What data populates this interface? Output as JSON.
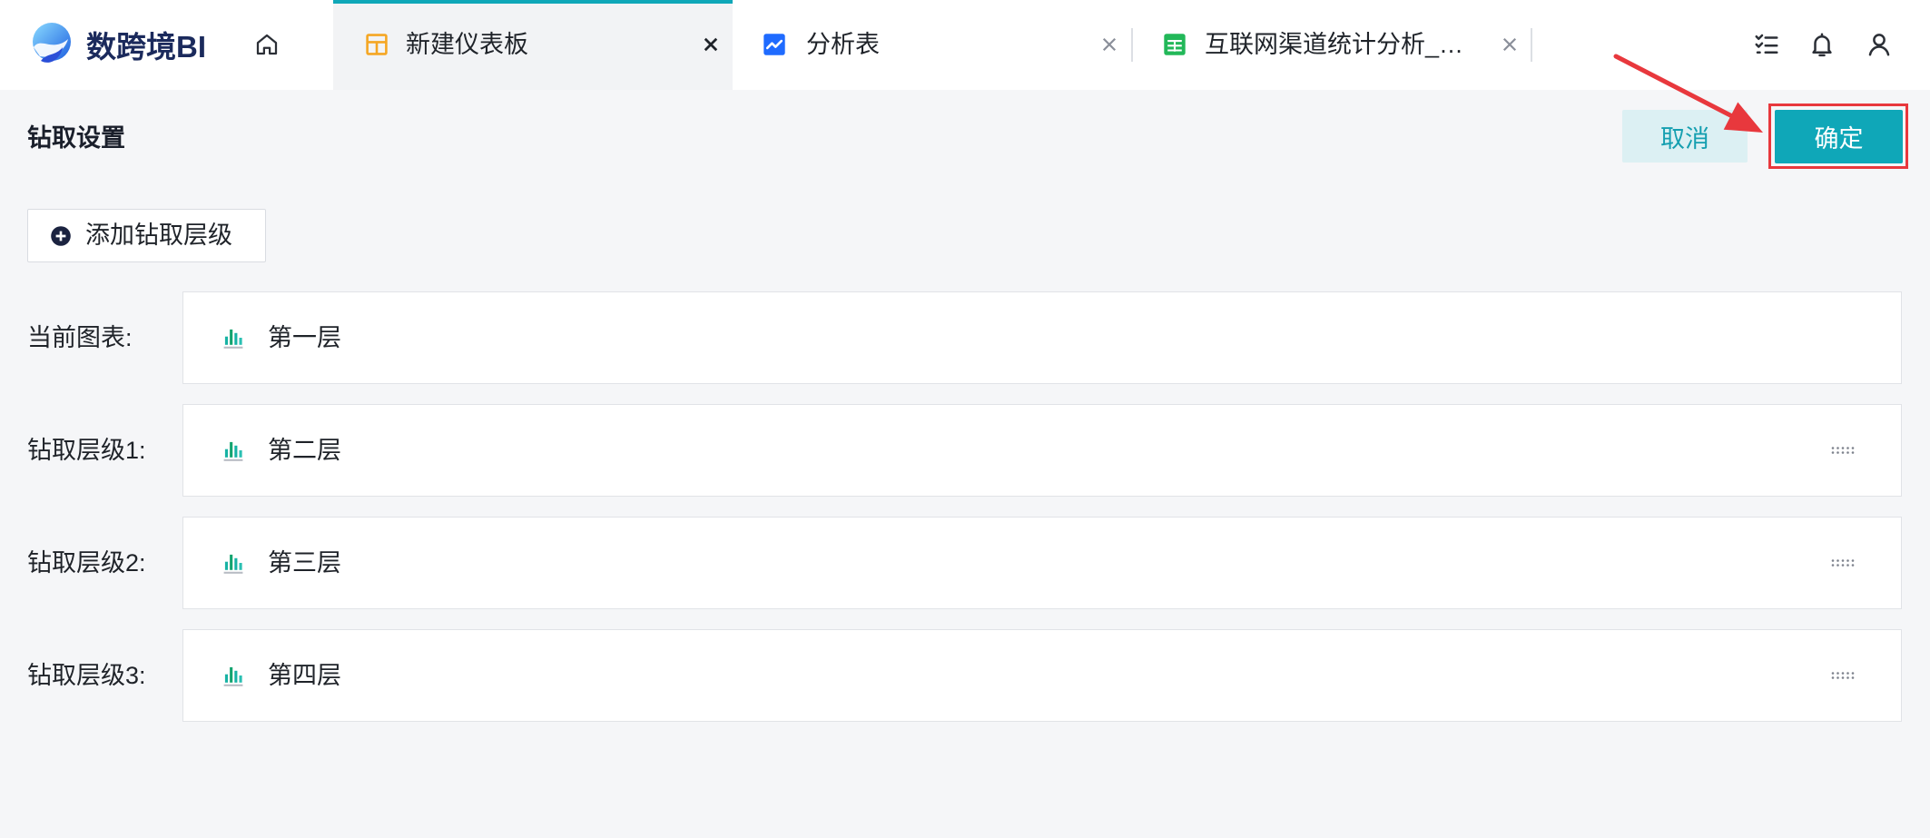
{
  "app": {
    "logo_text": "数跨境BI",
    "logo_icon": "brand-logo-icon",
    "home_icon": "home-icon"
  },
  "tabs": [
    {
      "label": "新建仪表板",
      "icon": "dashboard-icon",
      "icon_color": "#f5a623",
      "close_icon": "close-icon",
      "active": true
    },
    {
      "label": "分析表",
      "icon": "analysis-chart-icon",
      "icon_color": "#1f6bff",
      "close_icon": "close-icon",
      "active": false
    },
    {
      "label": "互联网渠道统计分析_…",
      "icon": "table-sheet-icon",
      "icon_color": "#22b859",
      "close_icon": "close-icon",
      "active": false
    }
  ],
  "header_actions": [
    {
      "icon": "task-list-icon"
    },
    {
      "icon": "bell-icon"
    },
    {
      "icon": "user-icon"
    }
  ],
  "drill_settings": {
    "title": "钻取设置",
    "cancel_label": "取消",
    "confirm_label": "确定",
    "add_level_label": "添加钻取层级",
    "add_level_icon": "plus-circle-icon",
    "drag_icon": "drag-handle-icon",
    "levels": [
      {
        "label": "当前图表:",
        "chart_name": "第一层",
        "icon": "bar-chart-icon",
        "draggable": false
      },
      {
        "label": "钻取层级1:",
        "chart_name": "第二层",
        "icon": "bar-chart-icon",
        "draggable": true
      },
      {
        "label": "钻取层级2:",
        "chart_name": "第三层",
        "icon": "bar-chart-icon",
        "draggable": true
      },
      {
        "label": "钻取层级3:",
        "chart_name": "第四层",
        "icon": "bar-chart-icon",
        "draggable": true
      }
    ]
  },
  "colors": {
    "primary": "#0fa7b8",
    "primary_text": "#159fb0",
    "cancel_bg": "#dcf0f3",
    "page_bg": "#f5f6f8",
    "active_tab_bg": "#f2f3f5",
    "annotation": "#e8383d"
  }
}
